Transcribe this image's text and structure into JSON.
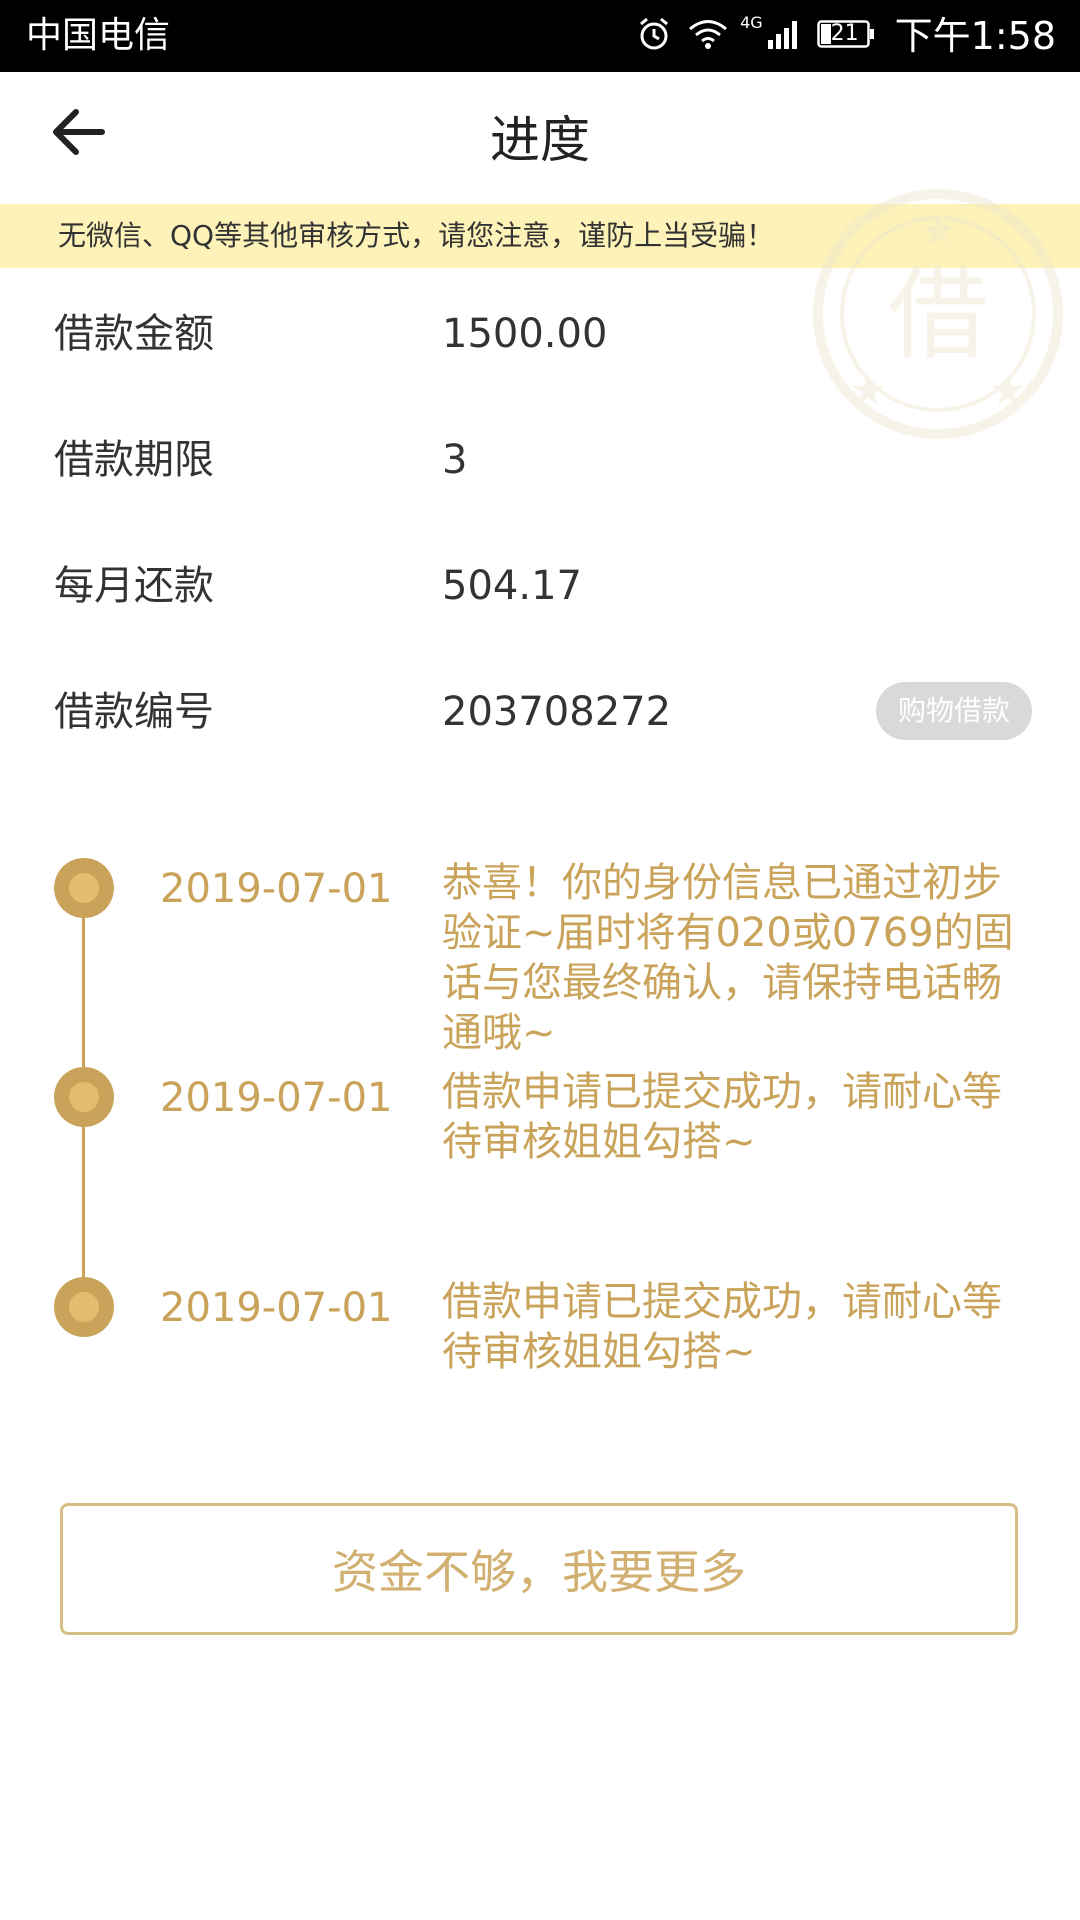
{
  "status_bar": {
    "carrier": "中国电信",
    "network": "4G",
    "battery": "21",
    "time": "下午1:58"
  },
  "header": {
    "title": "进度",
    "back_icon": "arrow-left-icon"
  },
  "notice": {
    "text": "无微信、QQ等其他审核方式，请您注意，谨防上当受骗！"
  },
  "watermark": {
    "glyph": "借"
  },
  "loan_info": {
    "amount_label": "借款金额",
    "amount_value": "1500.00",
    "term_label": "借款期限",
    "term_value": "3",
    "monthly_label": "每月还款",
    "monthly_value": "504.17",
    "number_label": "借款编号",
    "number_value": "203708272",
    "type_badge": "购物借款"
  },
  "timeline": [
    {
      "date": "2019-07-01",
      "text": "恭喜！你的身份信息已通过初步验证~届时将有020或0769的固话与您最终确认，请保持电话畅通哦~"
    },
    {
      "date": "2019-07-01",
      "text": "借款申请已提交成功，请耐心等待审核姐姐勾搭~"
    },
    {
      "date": "2019-07-01",
      "text": "借款申请已提交成功，请耐心等待审核姐姐勾搭~"
    }
  ],
  "actions": {
    "more_funds": "资金不够，我要更多"
  },
  "colors": {
    "accent": "#c9a35a",
    "notice_bg": "#fdf2b8",
    "badge_bg": "#d9d9d9"
  }
}
